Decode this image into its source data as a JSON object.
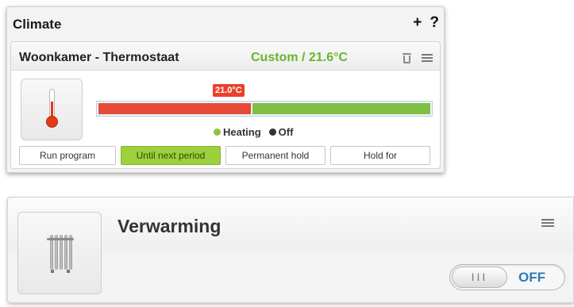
{
  "climate": {
    "title": "Climate",
    "add_label": "+",
    "help_label": "?",
    "device": {
      "name": "Woonkamer - Thermostaat",
      "mode": "Custom / 21.6°C",
      "marker_label": "21.0°C",
      "heating_fraction": 0.46,
      "legend": {
        "heating": "Heating",
        "off": "Off"
      },
      "buttons": {
        "run_program": "Run program",
        "until_next_period": "Until next period",
        "permanent_hold": "Permanent hold",
        "hold_for": "Hold for"
      },
      "active_button": "until_next_period"
    }
  },
  "heater": {
    "title": "Verwarming",
    "toggle_knob": "III",
    "toggle_state": "OFF"
  },
  "colors": {
    "mode_green": "#6ab42d",
    "heating_red": "#e74a35",
    "off_green": "#7fbf43",
    "active_button": "#9cd03c",
    "toggle_blue": "#2f79b7"
  },
  "icons": {
    "add": "plus-icon",
    "help": "question-icon",
    "trash": "trash-icon",
    "menu": "menu-icon",
    "thermometer": "thermometer-icon",
    "radiator": "radiator-icon"
  }
}
